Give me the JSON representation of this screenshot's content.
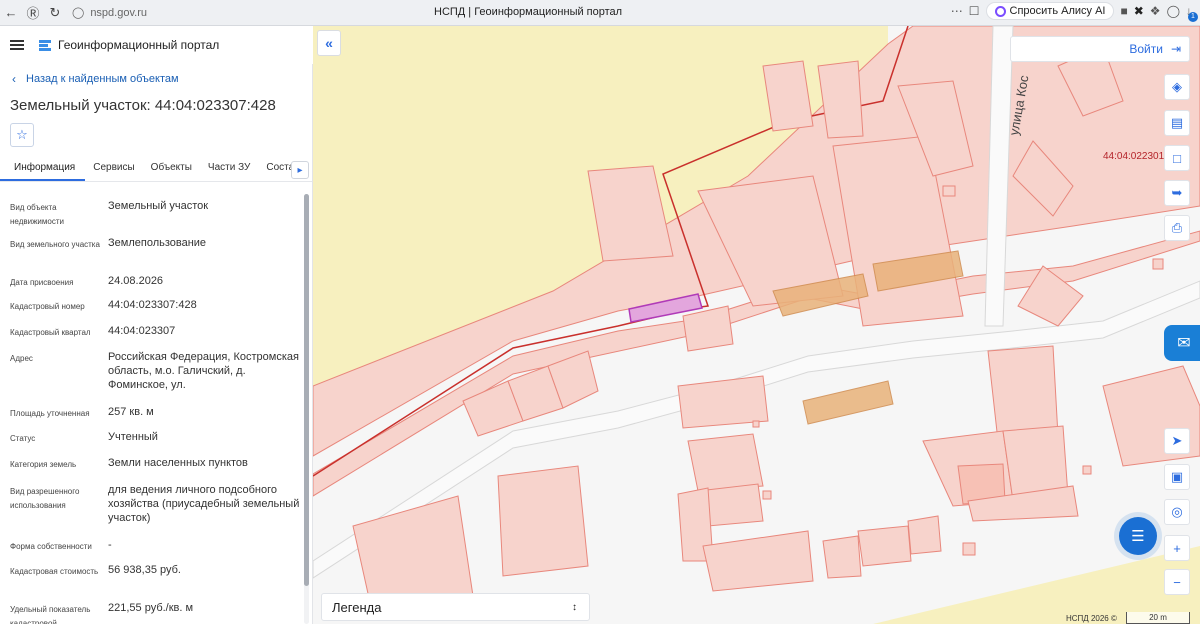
{
  "browser": {
    "url": "nspd.gov.ru",
    "tab_title": "НСПД | Геоинформационный портал",
    "alice_label": "Спросить Алису AI",
    "badge_count": "1"
  },
  "app": {
    "title": "Геоинформационный портал"
  },
  "panel": {
    "back_label": "Назад к найденным объектам",
    "title": "Земельный участок: 44:04:023307:428",
    "tabs": [
      {
        "label": "Информация"
      },
      {
        "label": "Сервисы"
      },
      {
        "label": "Объекты"
      },
      {
        "label": "Части ЗУ"
      },
      {
        "label": "Состав"
      }
    ],
    "properties": [
      {
        "label": "Вид объекта недвижимости",
        "value": "Земельный участок"
      },
      {
        "label": "Вид земельного участка",
        "value": "Землепользование"
      },
      {
        "label": "Дата присвоения",
        "value": "24.08.2026"
      },
      {
        "label": "Кадастровый номер",
        "value": "44:04:023307:428"
      },
      {
        "label": "Кадастровый квартал",
        "value": "44:04:023307"
      },
      {
        "label": "Адрес",
        "value": "Российская Федерация, Костромская область, м.о. Галичский, д. Фоминское, ул."
      },
      {
        "label": "Площадь уточненная",
        "value": "257 кв. м"
      },
      {
        "label": "Статус",
        "value": "Учтенный"
      },
      {
        "label": "Категория земель",
        "value": "Земли населенных пунктов"
      },
      {
        "label": "Вид разрешенного использования",
        "value": "для ведения личного подсобного хозяйства (приусадебный земельный участок)"
      },
      {
        "label": "Форма собственности",
        "value": "-"
      },
      {
        "label": "Кадастровая стоимость",
        "value": "56 938,35 руб."
      },
      {
        "label": "Удельный показатель кадастровой",
        "value": "221,55 руб./кв. м"
      }
    ]
  },
  "map": {
    "login_label": "Войти",
    "street_label": "улица Кос",
    "cadastral_label": "44:04:022301",
    "legend_label": "Легенда",
    "attribution": "НСПД 2026 ©",
    "scale_label": "20 m",
    "colors": {
      "parcel_fill": "#f7d3cc",
      "parcel_stroke": "#e8877c",
      "boundary": "#c9302c",
      "selected": "#b03ab8",
      "building": "#e9b27a",
      "field": "#f7f0bf",
      "accent": "#2d6cdf"
    }
  }
}
